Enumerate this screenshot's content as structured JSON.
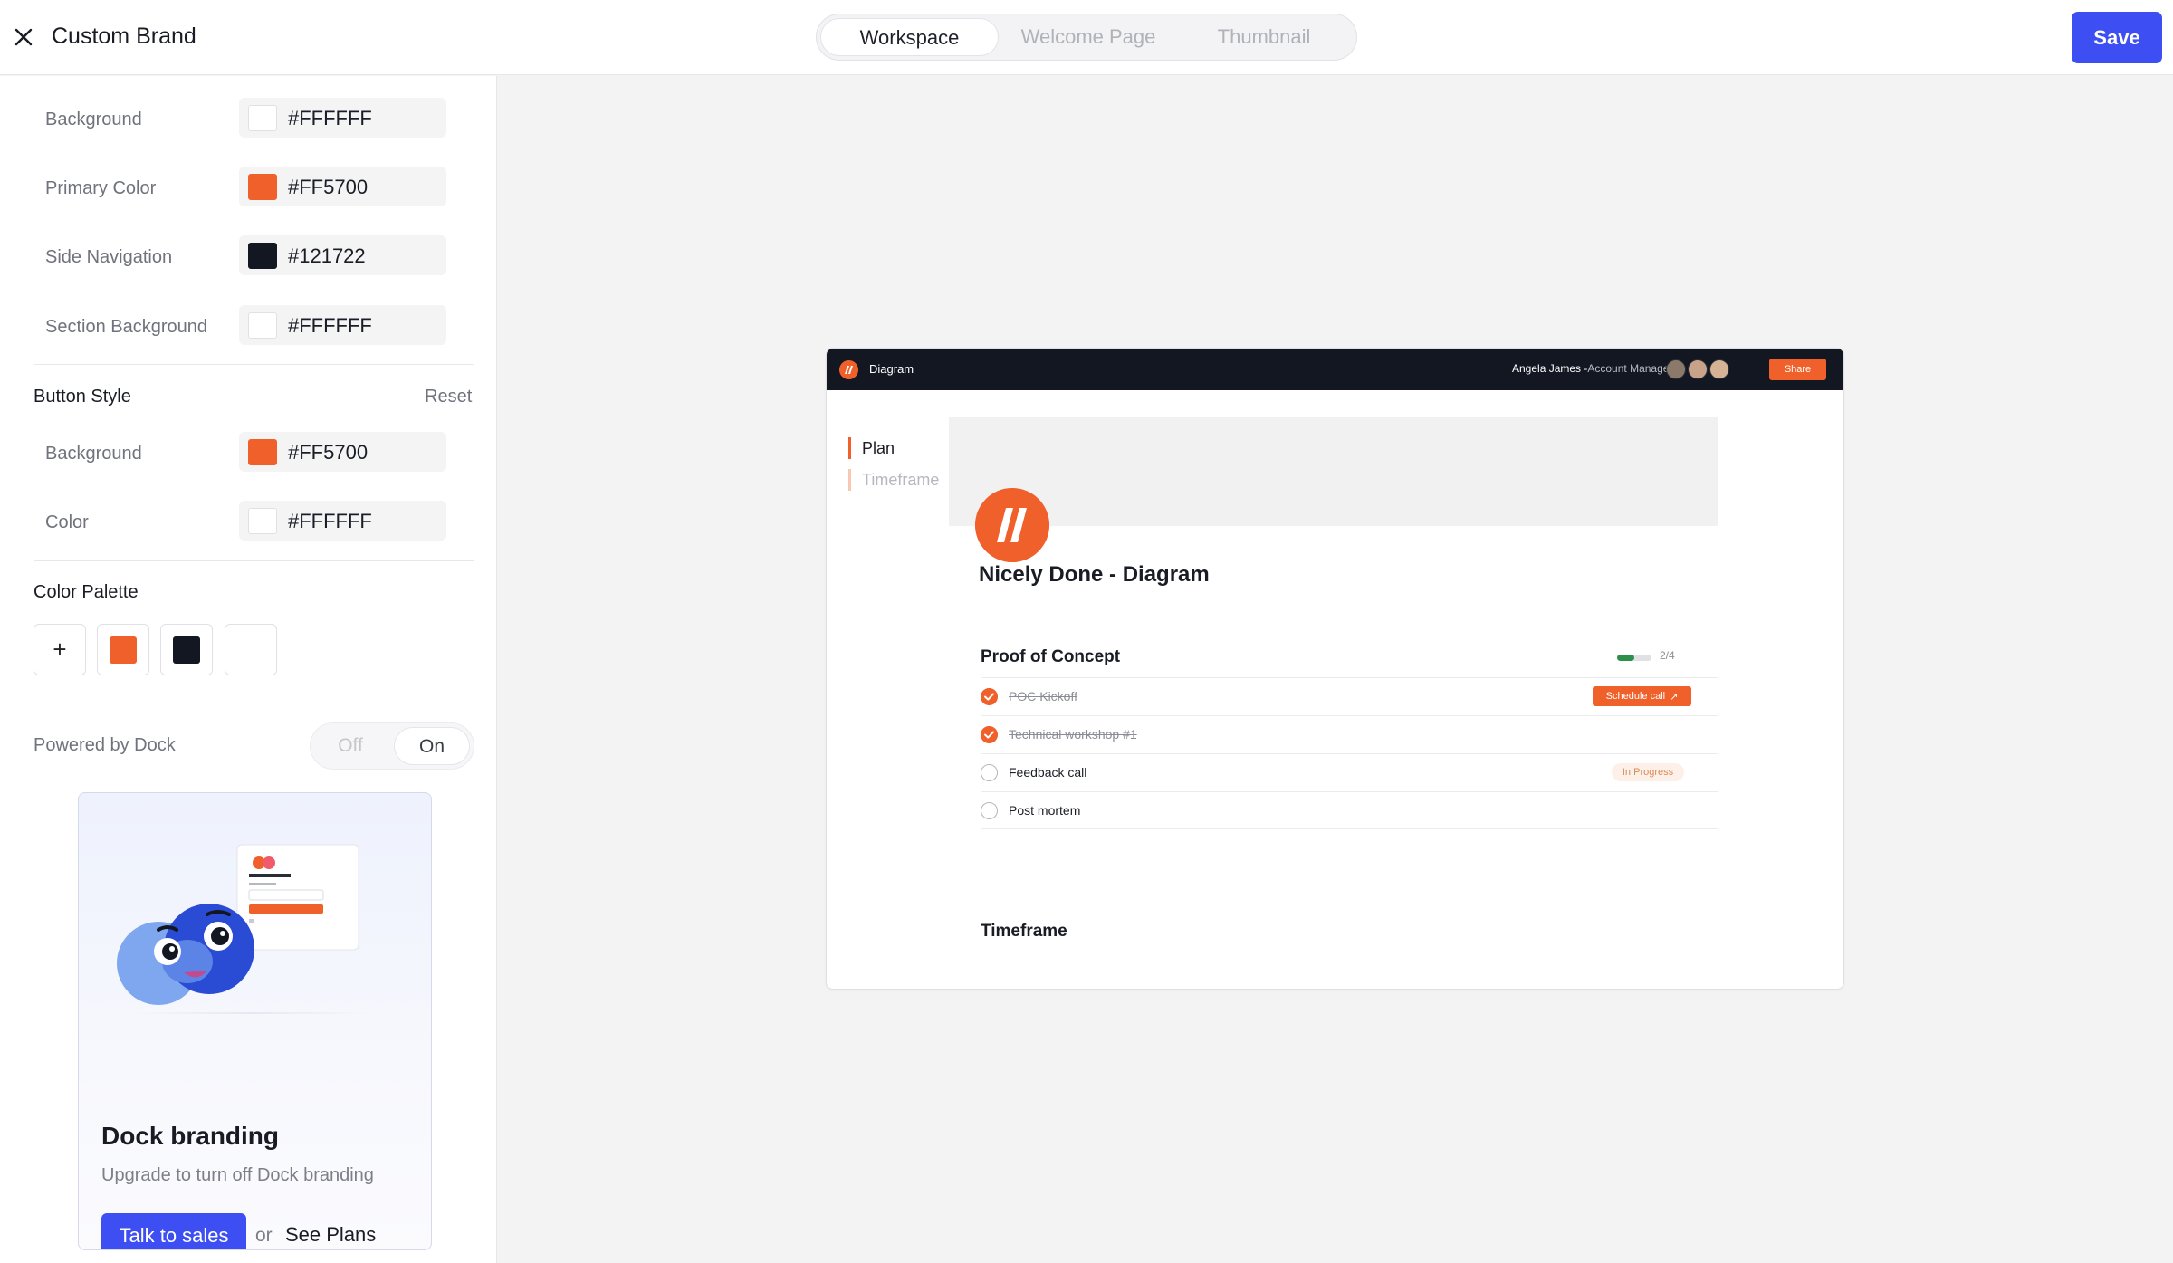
{
  "app": {
    "title": "Custom Brand",
    "save_label": "Save"
  },
  "tabs": [
    "Workspace",
    "Welcome Page",
    "Thumbnail"
  ],
  "colors_section": {
    "rows": [
      {
        "label": "Background",
        "hex": "#FFFFFF"
      },
      {
        "label": "Primary Color",
        "hex": "#FF5700"
      },
      {
        "label": "Side Navigation",
        "hex": "#121722"
      },
      {
        "label": "Section Background",
        "hex": "#FFFFFF"
      }
    ]
  },
  "button_style": {
    "title": "Button Style",
    "reset_label": "Reset",
    "rows": [
      {
        "label": "Background",
        "hex": "#FF5700"
      },
      {
        "label": "Color",
        "hex": "#FFFFFF"
      }
    ]
  },
  "palette": {
    "title": "Color Palette",
    "add_label": "+",
    "swatches": [
      "#F0602A",
      "#121722",
      "#FFFFFF"
    ]
  },
  "powered": {
    "label": "Powered by Dock",
    "off_label": "Off",
    "on_label": "On",
    "value": "On"
  },
  "promo": {
    "title": "Dock branding",
    "subtitle": "Upgrade to turn off Dock branding",
    "talk_label": "Talk to sales",
    "or_label": "or",
    "plans_label": "See Plans"
  },
  "preview": {
    "bar_title": "Diagram",
    "user_name": "Angela James -",
    "user_role": "Account Manager",
    "share_label": "Share",
    "nav": [
      "Plan",
      "Timeframe"
    ],
    "workspace_title": "Nicely Done - Diagram",
    "section_title": "Proof of Concept",
    "progress_text": "2/4",
    "progress_fraction": 0.5,
    "tasks": [
      {
        "label": "POC Kickoff",
        "done": true,
        "action": "Schedule call"
      },
      {
        "label": "Technical workshop #1",
        "done": true
      },
      {
        "label": "Feedback call",
        "done": false,
        "status": "In Progress"
      },
      {
        "label": "Post mortem",
        "done": false
      }
    ],
    "timeframe_title": "Timeframe"
  }
}
